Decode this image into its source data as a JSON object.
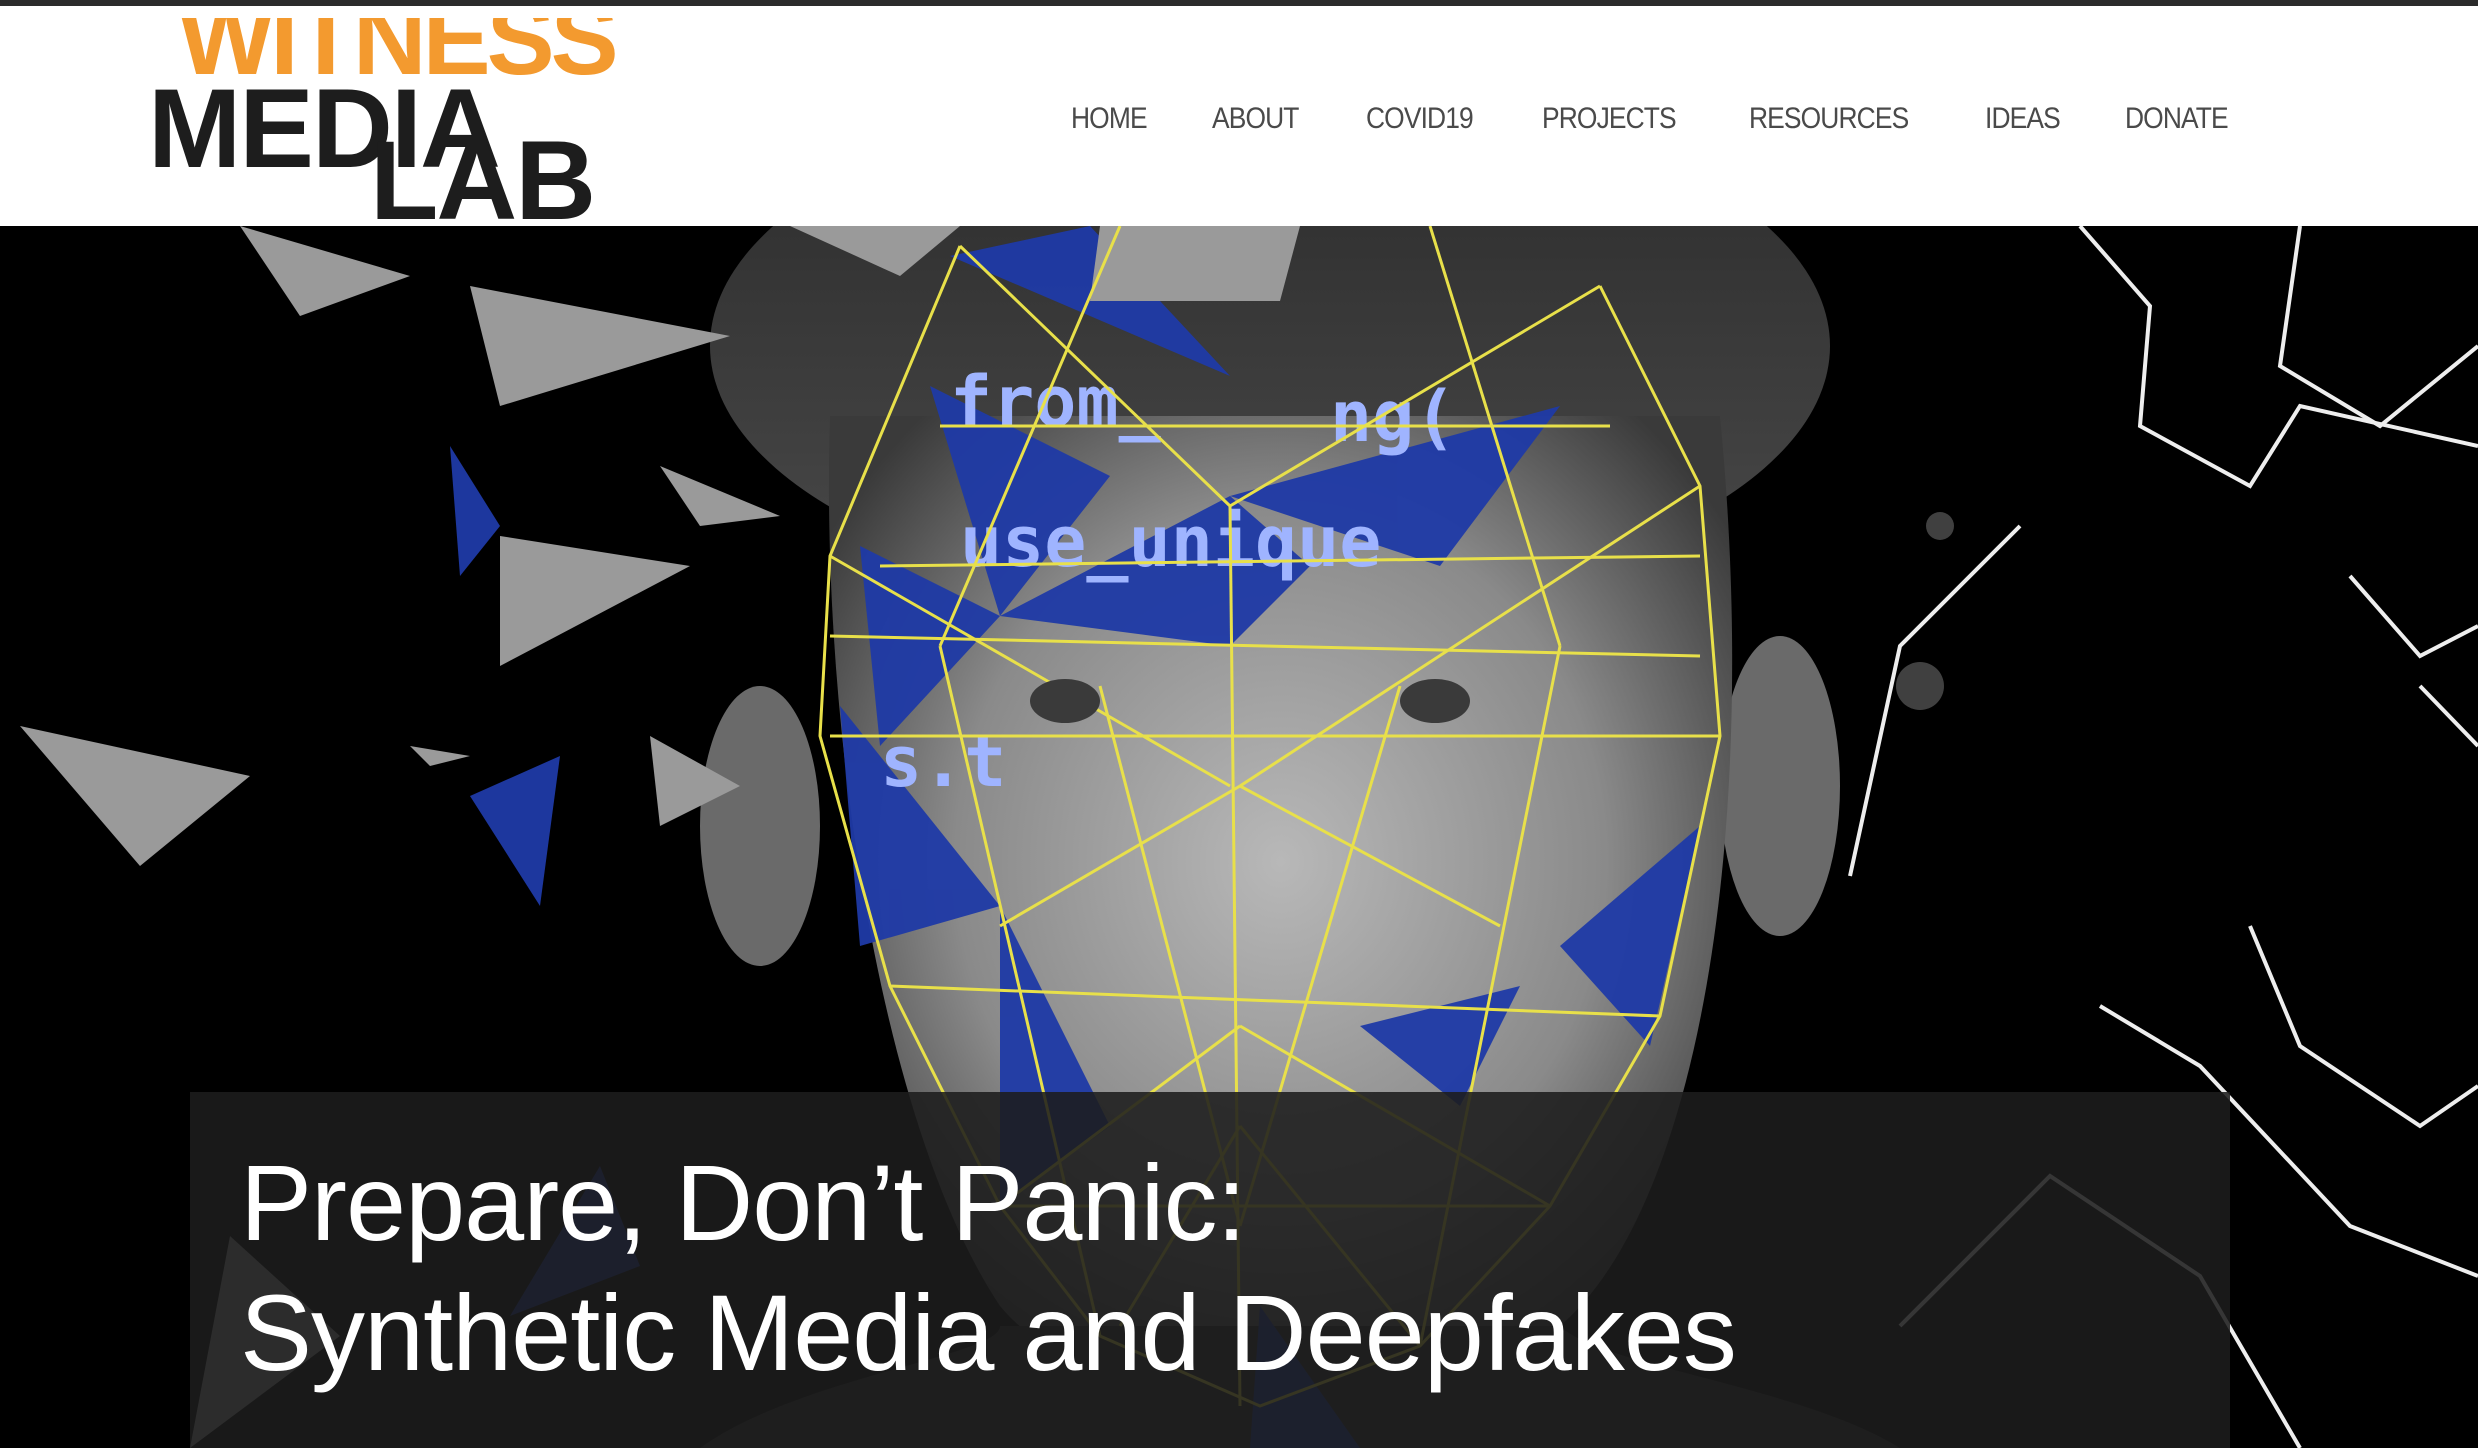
{
  "logo": {
    "line1": "WITNESS",
    "line2": "MEDIA",
    "line3": "LAB"
  },
  "nav": {
    "items": [
      {
        "label": "HOME"
      },
      {
        "label": "ABOUT"
      },
      {
        "label": "COVID19"
      },
      {
        "label": "PROJECTS"
      },
      {
        "label": "RESOURCES"
      },
      {
        "label": "IDEAS"
      },
      {
        "label": "DONATE"
      }
    ]
  },
  "hero": {
    "title_line1": "Prepare, Don’t Panic:",
    "title_line2": "Synthetic Media and Deepfakes"
  },
  "colors": {
    "accent_orange": "#f39a2f",
    "mesh_yellow": "#e8e04a",
    "code_blue": "#1f3aa6"
  }
}
